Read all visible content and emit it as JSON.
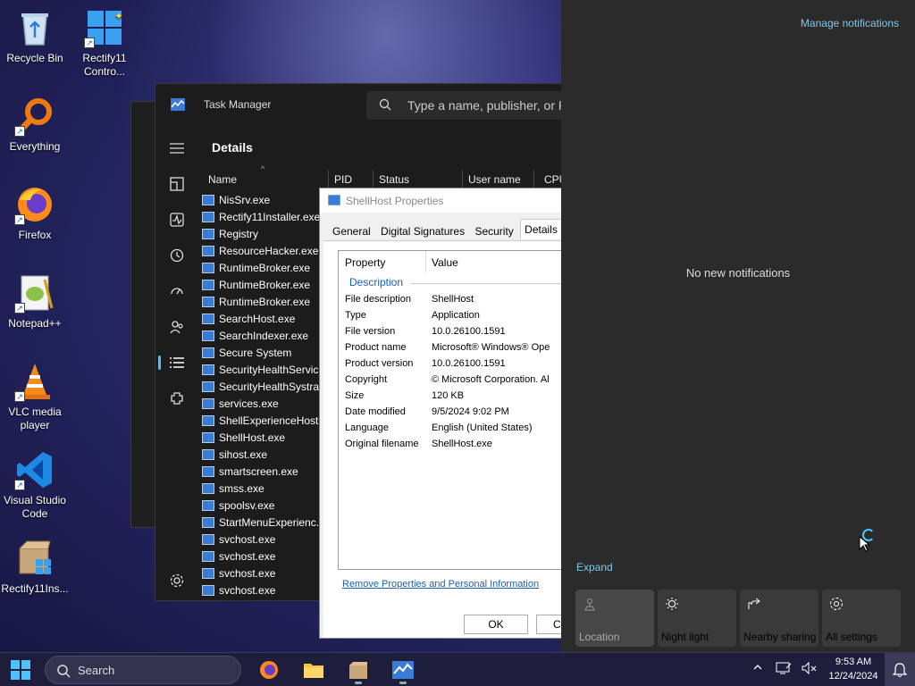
{
  "desktop": {
    "icons": [
      {
        "label": "Recycle Bin"
      },
      {
        "label": "Rectify11 Contro..."
      },
      {
        "label": "Everything"
      },
      {
        "label": "Firefox"
      },
      {
        "label": "Notepad++"
      },
      {
        "label": "VLC media player"
      },
      {
        "label": "Visual Studio Code"
      },
      {
        "label": "Rectify11Ins..."
      }
    ]
  },
  "task_manager": {
    "title": "Task Manager",
    "search_placeholder": "Type a name, publisher, or P",
    "heading": "Details",
    "columns": [
      "Name",
      "PID",
      "Status",
      "User name",
      "CPU"
    ],
    "processes": [
      "NisSrv.exe",
      "Rectify11Installer.exe",
      "Registry",
      "ResourceHacker.exe",
      "RuntimeBroker.exe",
      "RuntimeBroker.exe",
      "RuntimeBroker.exe",
      "SearchHost.exe",
      "SearchIndexer.exe",
      "Secure System",
      "SecurityHealthServic...",
      "SecurityHealthSystra...",
      "services.exe",
      "ShellExperienceHost...",
      "ShellHost.exe",
      "sihost.exe",
      "smartscreen.exe",
      "smss.exe",
      "spoolsv.exe",
      "StartMenuExperienc...",
      "svchost.exe",
      "svchost.exe",
      "svchost.exe",
      "svchost.exe"
    ]
  },
  "dialog": {
    "title": "ShellHost Properties",
    "tabs": [
      "General",
      "Digital Signatures",
      "Security",
      "Details"
    ],
    "col_property": "Property",
    "col_value": "Value",
    "group": "Description",
    "rows": [
      {
        "k": "File description",
        "v": "ShellHost"
      },
      {
        "k": "Type",
        "v": "Application"
      },
      {
        "k": "File version",
        "v": "10.0.26100.1591"
      },
      {
        "k": "Product name",
        "v": "Microsoft® Windows® Ope"
      },
      {
        "k": "Product version",
        "v": "10.0.26100.1591"
      },
      {
        "k": "Copyright",
        "v": "© Microsoft Corporation. Al"
      },
      {
        "k": "Size",
        "v": "120 KB"
      },
      {
        "k": "Date modified",
        "v": "9/5/2024 9:02 PM"
      },
      {
        "k": "Language",
        "v": "English (United States)"
      },
      {
        "k": "Original filename",
        "v": "ShellHost.exe"
      }
    ],
    "remove_link": "Remove Properties and Personal Information",
    "ok": "OK",
    "cancel": "Ca"
  },
  "notifications": {
    "manage": "Manage notifications",
    "empty": "No new notifications",
    "expand": "Expand",
    "quick": [
      {
        "label": "Location",
        "disabled": true
      },
      {
        "label": "Night light"
      },
      {
        "label": "Nearby sharing"
      },
      {
        "label": "All settings"
      }
    ]
  },
  "taskbar": {
    "search": "Search",
    "time": "9:53 AM",
    "date": "12/24/2024"
  },
  "colors": {
    "accent": "#4cc2ff",
    "link": "#1a5fb4"
  }
}
